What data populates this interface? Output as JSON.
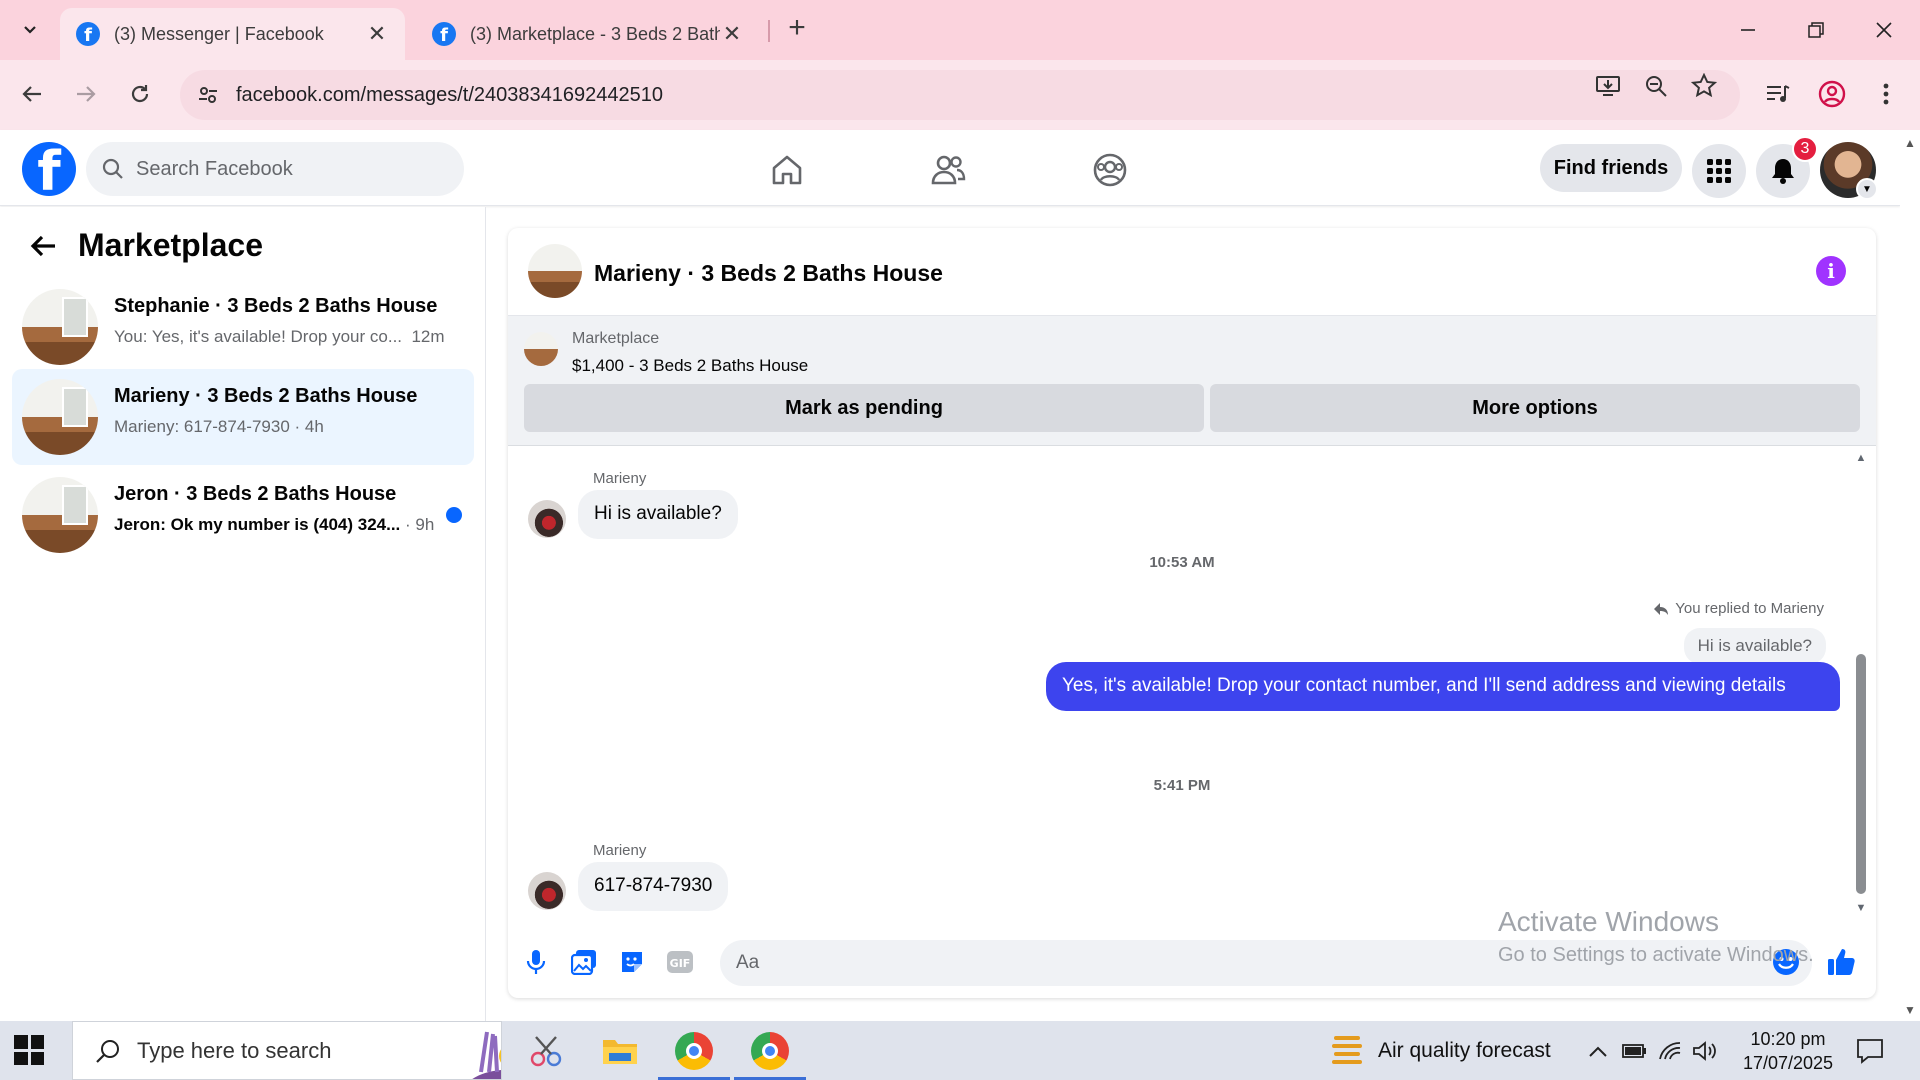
{
  "browser": {
    "tabs": [
      {
        "title": "(3) Messenger | Facebook",
        "active": true
      },
      {
        "title": "(3) Marketplace - 3 Beds 2 Bath",
        "active": false
      }
    ],
    "url": "facebook.com/messages/t/24038341692442510"
  },
  "fb_header": {
    "search_placeholder": "Search Facebook",
    "find_friends": "Find friends",
    "notification_count": "3"
  },
  "left_panel": {
    "title": "Marketplace",
    "conversations": [
      {
        "name": "Stephanie · 3 Beds 2 Baths House",
        "preview": "You: Yes, it's available! Drop your co...",
        "time": "12m",
        "selected": false,
        "unread": false
      },
      {
        "name": "Marieny · 3 Beds 2 Baths House",
        "preview": "Marieny: 617-874-7930",
        "time": "4h",
        "selected": true,
        "unread": false
      },
      {
        "name": "Jeron · 3 Beds 2 Baths House",
        "preview": "Jeron: Ok my number is (404) 324...",
        "time": "9h",
        "selected": false,
        "unread": true
      }
    ]
  },
  "chat": {
    "title": "Marieny · 3 Beds 2 Baths House",
    "listing": {
      "category": "Marketplace",
      "title": "$1,400 - 3 Beds 2 Baths House",
      "mark_pending": "Mark as pending",
      "more_options": "More options"
    },
    "messages": {
      "sender1": "Marieny",
      "msg1": "Hi  is available?",
      "time1": "10:53 AM",
      "reply_note": "You replied to Marieny",
      "quoted": "Hi  is available?",
      "reply": "Yes, it's available! Drop your contact number, and I'll send address and viewing details",
      "time2": "5:41 PM",
      "sender2": "Marieny",
      "msg2": "617-874-7930"
    },
    "composer_placeholder": "Aa"
  },
  "watermark": {
    "line1": "Activate Windows",
    "line2": "Go to Settings to activate Windows."
  },
  "taskbar": {
    "search_placeholder": "Type here to search",
    "weather": "Air quality forecast",
    "time": "10:20 pm",
    "date": "17/07/2025"
  }
}
